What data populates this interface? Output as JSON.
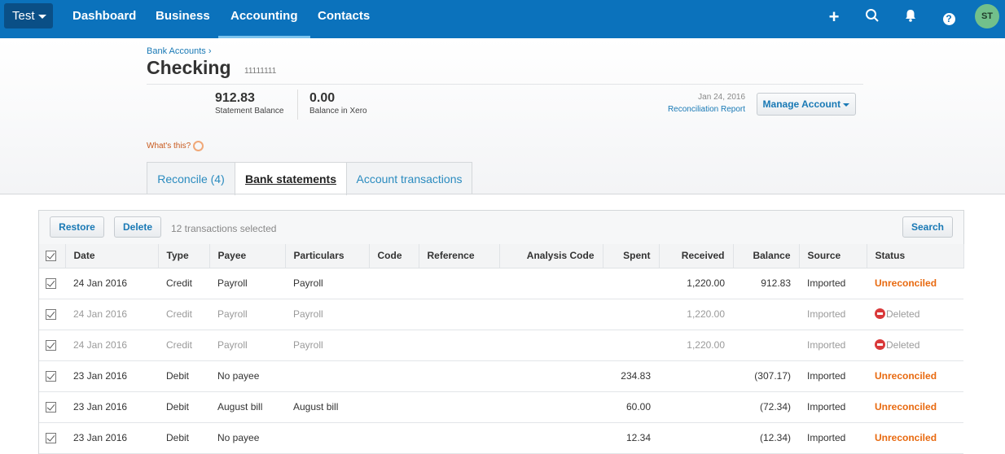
{
  "topbar": {
    "org": "Test",
    "nav": [
      "Dashboard",
      "Business",
      "Accounting",
      "Contacts"
    ],
    "active": "Accounting",
    "avatar": "ST"
  },
  "header": {
    "breadcrumb": "Bank Accounts ›",
    "title": "Checking",
    "account_number": "11111111",
    "statement_balance": "912.83",
    "statement_balance_label": "Statement Balance",
    "xero_balance": "0.00",
    "xero_balance_label": "Balance in Xero",
    "report_date": "Jan 24, 2016",
    "report_link": "Reconciliation Report",
    "manage_button": "Manage Account",
    "whats_this": "What's this?"
  },
  "tabs": [
    {
      "label": "Reconcile (4)"
    },
    {
      "label": "Bank statements"
    },
    {
      "label": "Account transactions"
    }
  ],
  "toolbar": {
    "restore": "Restore",
    "delete": "Delete",
    "selected": "12 transactions selected",
    "search": "Search"
  },
  "columns": [
    "Date",
    "Type",
    "Payee",
    "Particulars",
    "Code",
    "Reference",
    "Analysis Code",
    "Spent",
    "Received",
    "Balance",
    "Source",
    "Status"
  ],
  "rows": [
    {
      "date": "24 Jan 2016",
      "type": "Credit",
      "payee": "Payroll",
      "particulars": "Payroll",
      "code": "",
      "reference": "",
      "analysis": "",
      "spent": "",
      "received": "1,220.00",
      "balance": "912.83",
      "source": "Imported",
      "status": "Unreconciled"
    },
    {
      "date": "24 Jan 2016",
      "type": "Credit",
      "payee": "Payroll",
      "particulars": "Payroll",
      "code": "",
      "reference": "",
      "analysis": "",
      "spent": "",
      "received": "1,220.00",
      "balance": "",
      "source": "Imported",
      "status": "Deleted"
    },
    {
      "date": "24 Jan 2016",
      "type": "Credit",
      "payee": "Payroll",
      "particulars": "Payroll",
      "code": "",
      "reference": "",
      "analysis": "",
      "spent": "",
      "received": "1,220.00",
      "balance": "",
      "source": "Imported",
      "status": "Deleted"
    },
    {
      "date": "23 Jan 2016",
      "type": "Debit",
      "payee": "No payee",
      "particulars": "",
      "code": "",
      "reference": "",
      "analysis": "",
      "spent": "234.83",
      "received": "",
      "balance": "(307.17)",
      "source": "Imported",
      "status": "Unreconciled"
    },
    {
      "date": "23 Jan 2016",
      "type": "Debit",
      "payee": "August bill",
      "particulars": "August bill",
      "code": "",
      "reference": "",
      "analysis": "",
      "spent": "60.00",
      "received": "",
      "balance": "(72.34)",
      "source": "Imported",
      "status": "Unreconciled"
    },
    {
      "date": "23 Jan 2016",
      "type": "Debit",
      "payee": "No payee",
      "particulars": "",
      "code": "",
      "reference": "",
      "analysis": "",
      "spent": "12.34",
      "received": "",
      "balance": "(12.34)",
      "source": "Imported",
      "status": "Unreconciled"
    }
  ]
}
